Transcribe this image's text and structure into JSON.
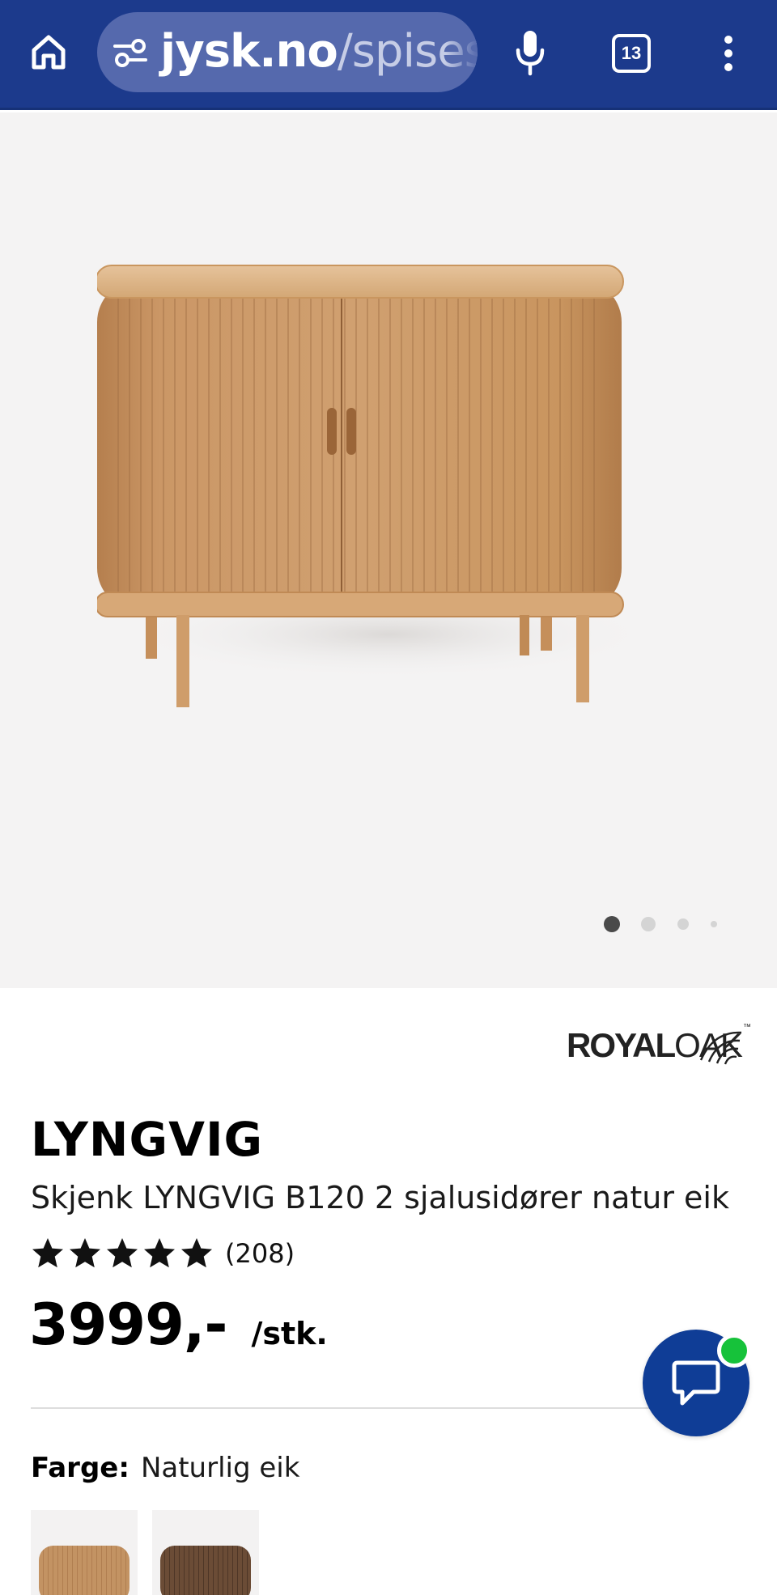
{
  "browser": {
    "url_domain": "jysk.no",
    "url_path": "/spisest",
    "tab_count": "13"
  },
  "gallery": {
    "image_count": 4,
    "active_index": 0
  },
  "brand": {
    "logo_royal": "ROYAL",
    "logo_oak": "OAK",
    "logo_tm": "™"
  },
  "product": {
    "title": "LYNGVIG",
    "description": "Skjenk LYNGVIG B120 2 sjalusidører natur eik",
    "rating": 5,
    "review_count": "(208)",
    "price": "3999,-",
    "unit": "/stk.",
    "color_label": "Farge:",
    "color_value": "Naturlig eik"
  },
  "colors": {
    "brand_blue": "#1c3a8c",
    "chat_blue": "#0f3d96",
    "online_green": "#16c23a",
    "swatch_oak": "#c39363",
    "swatch_dark": "#6b4c36"
  }
}
